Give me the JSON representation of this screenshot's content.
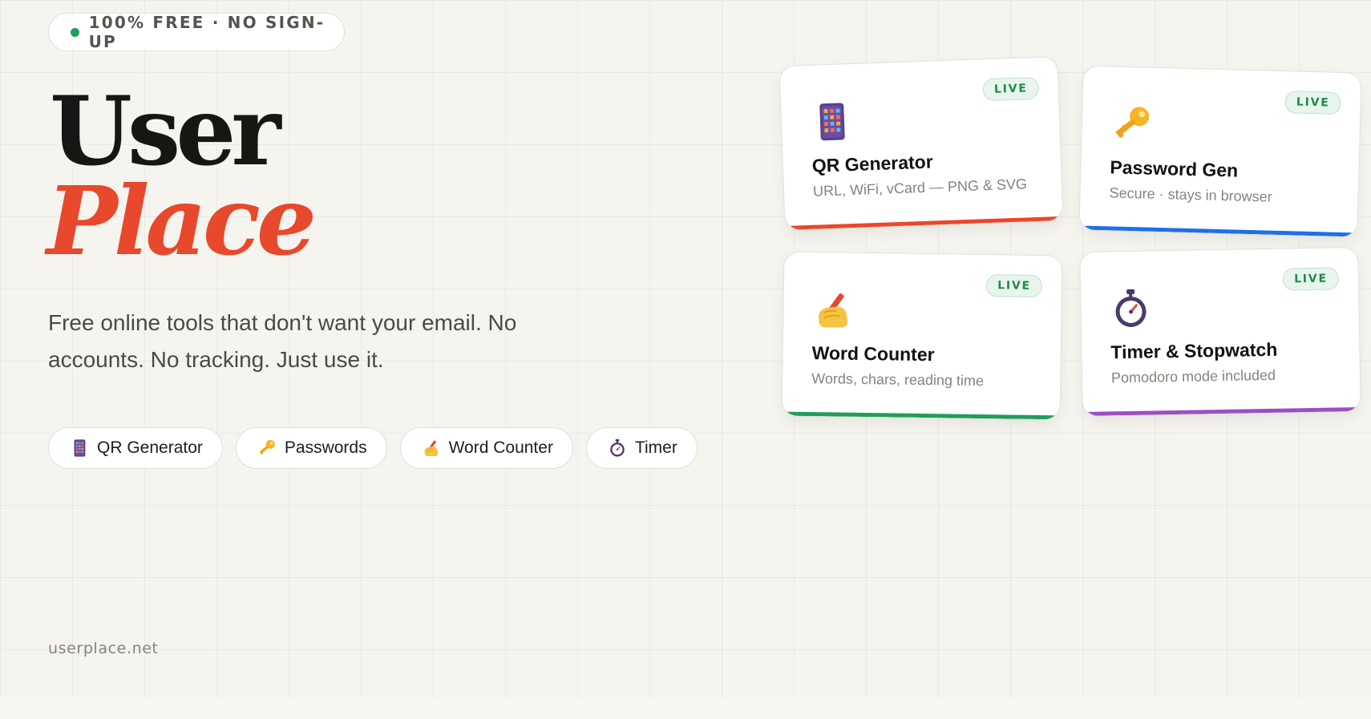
{
  "badge": {
    "text": "100% FREE · NO SIGN-UP",
    "dot_color": "#1f9d5a"
  },
  "hero": {
    "title_line1": "User",
    "title_line2": "Place",
    "title_accent_color": "#e8482b",
    "description": "Free online tools that don't want your email. No accounts. No tracking. Just use it."
  },
  "pills": [
    {
      "label": "QR Generator",
      "icon": "calculator-icon"
    },
    {
      "label": "Passwords",
      "icon": "key-icon"
    },
    {
      "label": "Word Counter",
      "icon": "writing-hand-icon"
    },
    {
      "label": "Timer",
      "icon": "stopwatch-icon"
    }
  ],
  "cards": [
    {
      "title": "QR Generator",
      "subtitle": "URL, WiFi, vCard — PNG & SVG",
      "status": "LIVE",
      "icon": "calculator-icon",
      "accent_color": "#e8482b"
    },
    {
      "title": "Password Gen",
      "subtitle": "Secure · stays in browser",
      "status": "LIVE",
      "icon": "key-icon",
      "accent_color": "#1f6fe5"
    },
    {
      "title": "Word Counter",
      "subtitle": "Words, chars, reading time",
      "status": "LIVE",
      "icon": "writing-hand-icon",
      "accent_color": "#1f9d5a"
    },
    {
      "title": "Timer & Stopwatch",
      "subtitle": "Pomodoro mode included",
      "status": "LIVE",
      "icon": "stopwatch-icon",
      "accent_color": "#9b4fc4"
    }
  ],
  "footer": {
    "domain": "userplace.net"
  }
}
